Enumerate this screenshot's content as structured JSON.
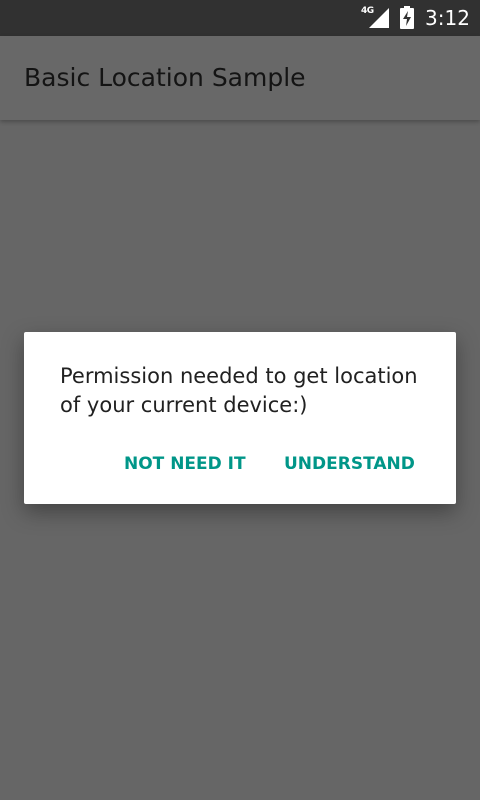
{
  "status_bar": {
    "network_type": "4G",
    "time": "3:12",
    "signal_icon": "cell-signal-icon",
    "battery_icon": "battery-charging-icon"
  },
  "toolbar": {
    "title": "Basic Location Sample"
  },
  "dialog": {
    "message": "Permission needed to get location of your current device:)",
    "negative_label": "NOT NEED IT",
    "positive_label": "UNDERSTAND"
  },
  "colors": {
    "accent": "#009688",
    "scrim": "#666666",
    "status_bar": "#313131"
  }
}
